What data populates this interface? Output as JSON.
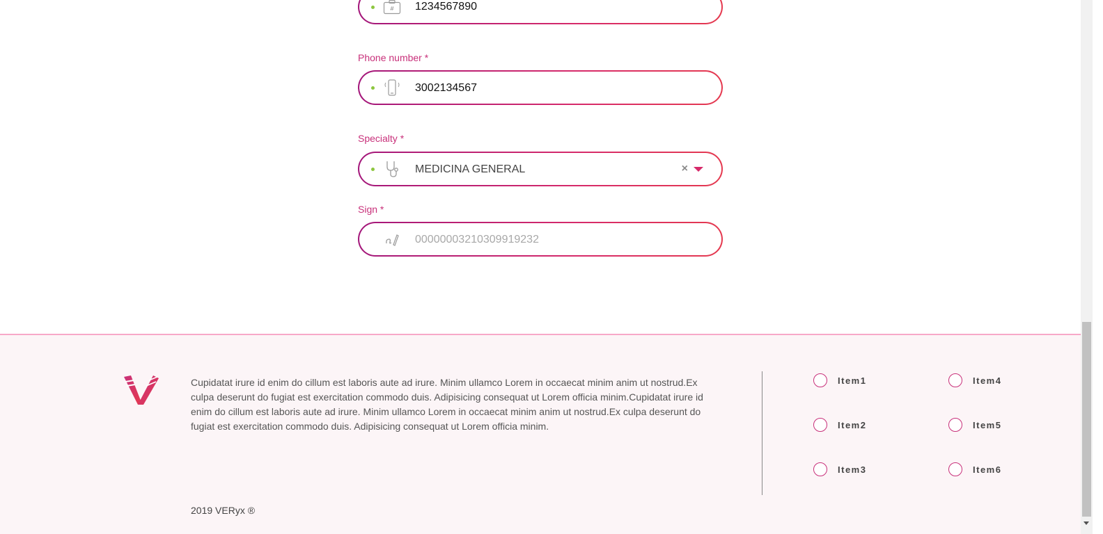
{
  "form": {
    "id_field": {
      "value": "1234567890",
      "icon": "id-card-icon"
    },
    "phone": {
      "label": "Phone number *",
      "value": "3002134567",
      "icon": "mobile-phone-icon"
    },
    "specialty": {
      "label": "Specialty *",
      "value": "MEDICINA GENERAL",
      "icon": "stethoscope-icon",
      "clear": "×"
    },
    "sign": {
      "label": "Sign *",
      "placeholder": "0000000321030991923​2",
      "icon": "signature-icon"
    }
  },
  "footer": {
    "description": "Cupidatat irure id enim do cillum est laboris aute ad irure. Minim ullamco Lorem in occaecat minim anim ut nostrud.Ex culpa deserunt do fugiat est exercitation commodo duis. Adipisicing consequat ut Lorem officia minim.Cupidatat irure id enim do cillum est laboris aute ad irure. Minim ullamco Lorem in occaecat minim anim ut nostrud.Ex culpa deserunt do fugiat est exercitation commodo duis. Adipisicing consequat ut Lorem officia minim.",
    "items": [
      "Item1",
      "Item2",
      "Item3",
      "Item4",
      "Item5",
      "Item6"
    ],
    "copyright": "2019 VERyx ®"
  },
  "colors": {
    "accent": "#d62a6a",
    "accent_dark": "#a3167a",
    "indicator_green": "#8dc63f",
    "footer_bg": "#fcf5f7"
  }
}
